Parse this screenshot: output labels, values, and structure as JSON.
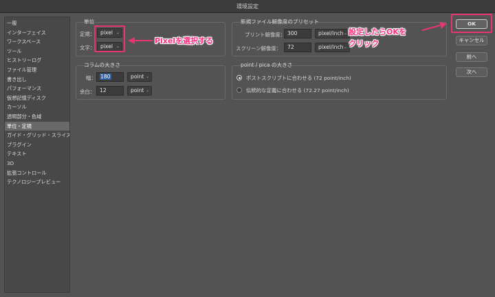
{
  "window": {
    "title": "環境設定"
  },
  "sidebar": {
    "items": [
      {
        "label": "一般"
      },
      {
        "label": "インターフェイス"
      },
      {
        "label": "ワークスペース"
      },
      {
        "label": "ツール"
      },
      {
        "label": "ヒストリーログ"
      },
      {
        "label": "ファイル管理"
      },
      {
        "label": "書き出し"
      },
      {
        "label": "パフォーマンス"
      },
      {
        "label": "仮想記憶ディスク"
      },
      {
        "label": "カーソル"
      },
      {
        "label": "透明部分・色域"
      },
      {
        "label": "単位・定規",
        "selected": true
      },
      {
        "label": "ガイド・グリッド・スライス"
      },
      {
        "label": "プラグイン"
      },
      {
        "label": "テキスト"
      },
      {
        "label": "3D"
      },
      {
        "label": "拡張コントロール"
      },
      {
        "label": "テクノロジープレビュー"
      }
    ]
  },
  "units": {
    "title": "単位",
    "ruler_label": "定規：",
    "ruler_value": "pixel",
    "type_label": "文字：",
    "type_value": "pixel"
  },
  "column": {
    "title": "コラムの大きさ",
    "width_label": "幅：",
    "width_value": "180",
    "width_unit": "point",
    "gutter_label": "余白：",
    "gutter_value": "12",
    "gutter_unit": "point"
  },
  "preset": {
    "title": "新規ファイル解像度のプリセット",
    "print_label": "プリント解像度：",
    "print_value": "300",
    "print_unit": "pixel/inch",
    "screen_label": "スクリーン解像度：",
    "screen_value": "72",
    "screen_unit": "pixel/inch"
  },
  "pica": {
    "title": "point / pica の大きさ",
    "option1": "ポストスクリプトに合わせる (72 point/inch)",
    "option2": "伝統的な定義に合わせる (72.27 point/inch)",
    "selected": "option1"
  },
  "buttons": {
    "ok": "OK",
    "cancel": "キャンセル",
    "prev": "前へ",
    "next": "次へ"
  },
  "annotations": {
    "pixel_note": "Pixelを選択する",
    "ok_note_line1": "設定したらOKを",
    "ok_note_line2": "クリック",
    "color": "#e83471"
  }
}
